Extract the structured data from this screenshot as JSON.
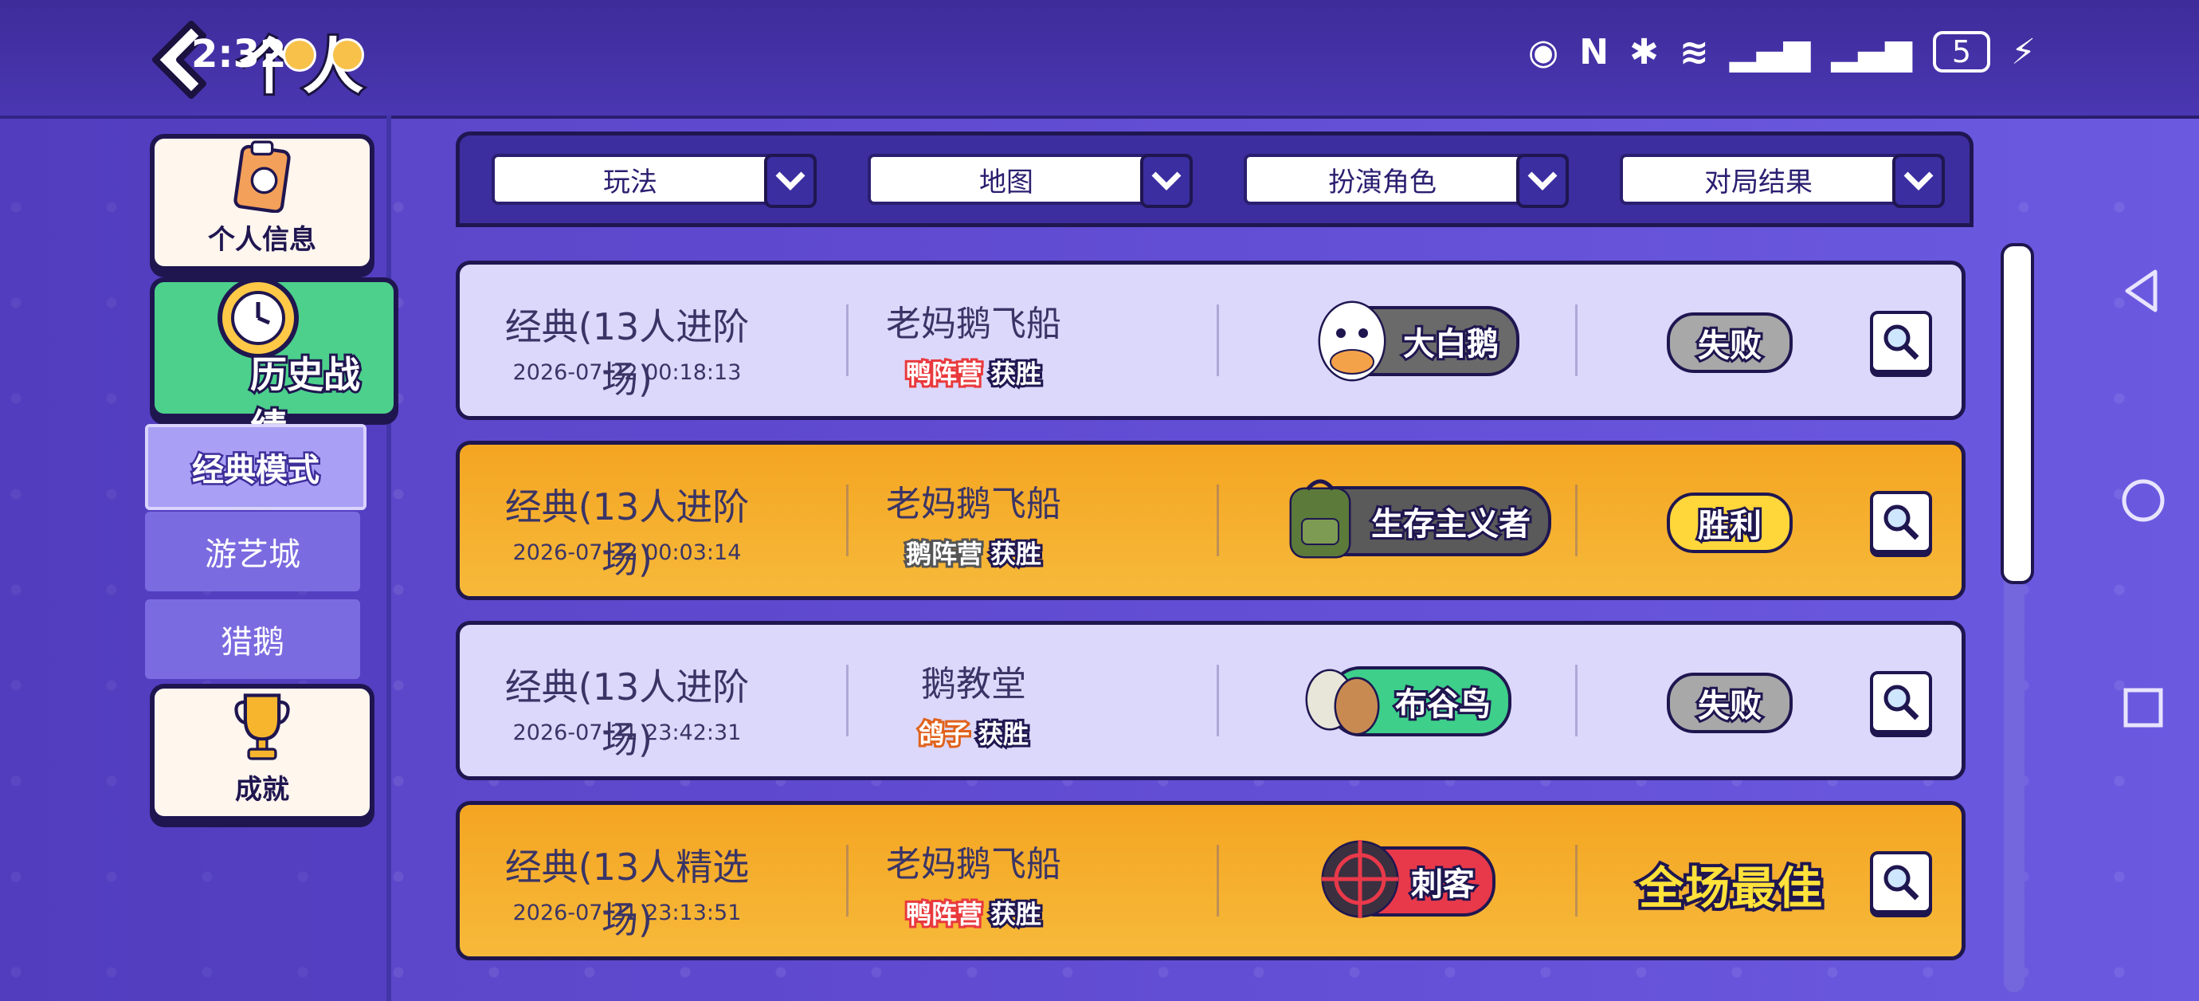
{
  "status_bar": {
    "time": "2:32",
    "battery": "5"
  },
  "header": {
    "title": "个人"
  },
  "sidebar": {
    "profile_label": "个人信息",
    "history_label": "历史战绩",
    "modes": [
      "经典模式",
      "游艺城",
      "猎鹅"
    ],
    "achievements_label": "成就"
  },
  "filters": {
    "mode": "玩法",
    "map": "地图",
    "role": "扮演角色",
    "result": "对局结果"
  },
  "matches": [
    {
      "mode": "经典(13人进阶场)",
      "date": "2026-07-22 00:18:13",
      "map": "老妈鹅飞船",
      "camp": "鸭阵营",
      "camp_result": "获胜",
      "role": "大白鹅",
      "result": "失败",
      "result_color": "#a8a8a8",
      "row_theme": "loss"
    },
    {
      "mode": "经典(13人进阶场)",
      "date": "2026-07-22 00:03:14",
      "map": "老妈鹅飞船",
      "camp": "鹅阵营",
      "camp_result": "获胜",
      "role": "生存主义者",
      "result": "胜利",
      "result_color": "#ffd73a",
      "row_theme": "win"
    },
    {
      "mode": "经典(13人进阶场)",
      "date": "2026-07-21 23:42:31",
      "map": "鹅教堂",
      "camp": "鸽子",
      "camp_result": "获胜",
      "role": "布谷鸟",
      "result": "失败",
      "result_color": "#a8a8a8",
      "row_theme": "loss"
    },
    {
      "mode": "经典(13人精选场)",
      "date": "2026-07-21 23:13:51",
      "map": "老妈鹅飞船",
      "camp": "鸭阵营",
      "camp_result": "获胜",
      "role": "刺客",
      "result": "全场最佳",
      "result_color": "#ffe23a",
      "row_theme": "win"
    }
  ],
  "colors": {
    "accent": "#5a43c4",
    "history_green": "#4cd08c",
    "win_row": "#f4a522",
    "loss_row": "#dcd8fb"
  }
}
